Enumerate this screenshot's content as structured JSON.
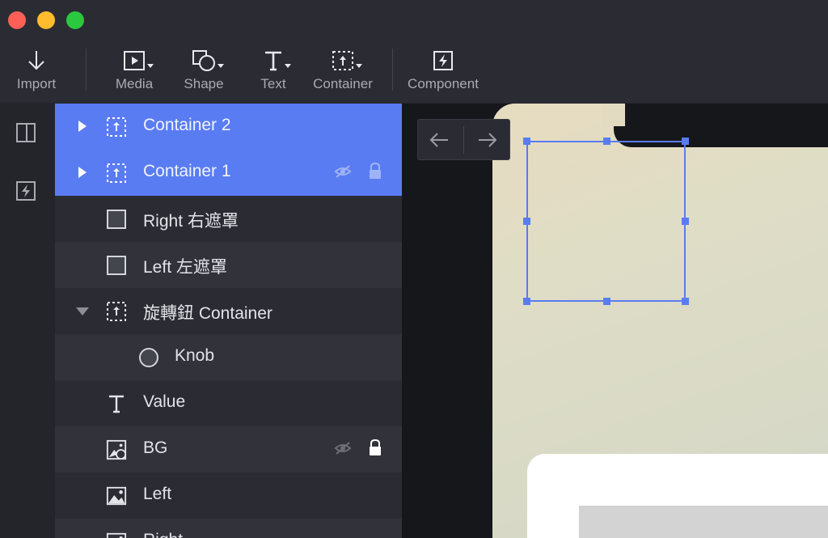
{
  "toolbar": {
    "import": "Import",
    "media": "Media",
    "shape": "Shape",
    "text": "Text",
    "container": "Container",
    "component": "Component"
  },
  "layers": [
    {
      "name": "Container 2",
      "icon": "container-icon",
      "state": "selected",
      "expander": "collapsed"
    },
    {
      "name": "Container 1",
      "icon": "container-icon",
      "state": "selected",
      "expander": "collapsed",
      "hidden": true,
      "locked": true
    },
    {
      "name": "Right 右遮罩",
      "icon": "rectangle-icon"
    },
    {
      "name": "Left 左遮罩",
      "icon": "rectangle-icon"
    },
    {
      "name": "旋轉鈕 Container",
      "icon": "container-icon",
      "expander": "expanded"
    },
    {
      "name": "Knob",
      "icon": "circle-icon",
      "indent": 1
    },
    {
      "name": "Value",
      "icon": "text-icon"
    },
    {
      "name": "BG",
      "icon": "image-shape-icon",
      "hidden": true,
      "locked": true
    },
    {
      "name": "Left",
      "icon": "image-icon"
    },
    {
      "name": "Right",
      "icon": "image-icon"
    }
  ],
  "colors": {
    "accent": "#5a7cf2",
    "panel": "#2b2c33",
    "canvas": "#16171b"
  }
}
